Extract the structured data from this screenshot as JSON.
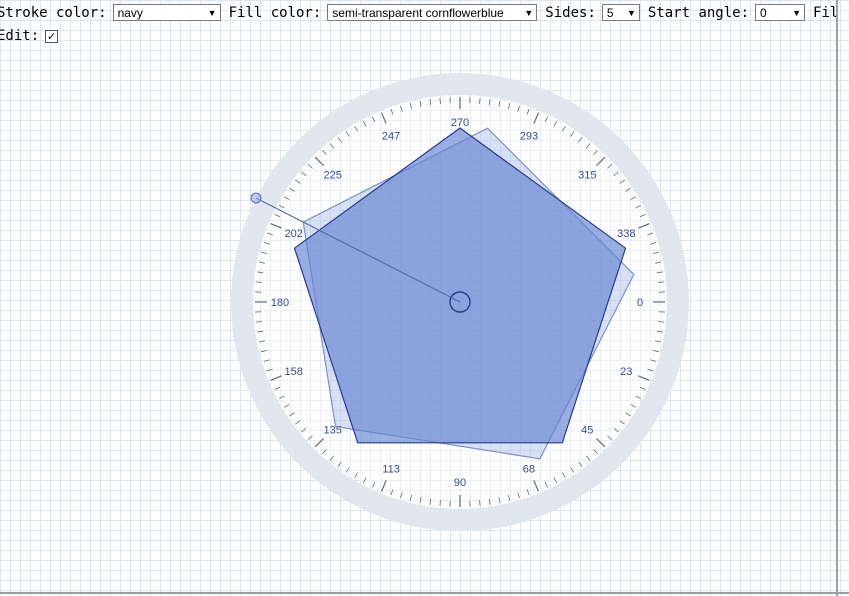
{
  "toolbar": {
    "stroke_label": "Stroke color:",
    "stroke_value": "navy",
    "fill_label": "Fill color:",
    "fill_value": "semi-transparent cornflowerblue",
    "sides_label": "Sides:",
    "sides_value": "5",
    "angle_label": "Start angle:",
    "angle_value": "0",
    "fill_cut_label": "Fill",
    "edit_label": "Edit:",
    "edit_checked": "✓"
  },
  "dial": {
    "labels": [
      "0",
      "23",
      "45",
      "68",
      "90",
      "113",
      "135",
      "158",
      "180",
      "202",
      "225",
      "247",
      "270",
      "293",
      "315",
      "338"
    ]
  },
  "colors": {
    "stroke": "#2a3a8c",
    "fill": "rgba(100,130,210,0.65)",
    "ghost_fill": "rgba(100,130,210,0.25)",
    "ring": "#e2e6ef"
  }
}
